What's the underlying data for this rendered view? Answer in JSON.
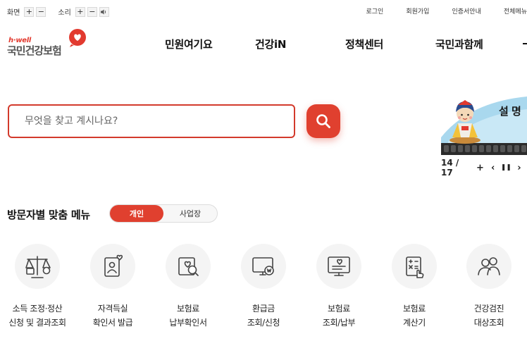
{
  "utility": {
    "screen_label": "화면",
    "sound_label": "소리",
    "plus": "+",
    "minus": "−",
    "links": [
      "로그인",
      "회원가입",
      "인증서안내",
      "전체메뉴"
    ]
  },
  "logo": {
    "tagline": "h·well",
    "name": "국민건강보험",
    "brand_color": "#e23a2f"
  },
  "gnb": {
    "items": [
      "민원여기요",
      "건강iN",
      "정책센터",
      "국민과함께"
    ]
  },
  "search": {
    "placeholder": "무엇을 찾고 계시나요?",
    "icon": "search-icon",
    "accent": "#e0402f"
  },
  "banner": {
    "text": "설 명",
    "counter": "14 / 17",
    "controls": {
      "add": "+",
      "prev": "‹",
      "pause": "❚❚",
      "next": "›"
    }
  },
  "custom_menu": {
    "title": "방문자별 맞춤 메뉴",
    "tabs": [
      "개인",
      "사업장"
    ],
    "active_tab": "개인",
    "items": [
      {
        "line1": "소득 조정·정산",
        "line2": "신청 및 결과조회",
        "icon": "scale-icon"
      },
      {
        "line1": "자격득실",
        "line2": "확인서 발급",
        "icon": "certificate-icon"
      },
      {
        "line1": "보험료",
        "line2": "납부확인서",
        "icon": "document-search-icon"
      },
      {
        "line1": "환급금",
        "line2": "조회/신청",
        "icon": "refund-monitor-icon"
      },
      {
        "line1": "보험료",
        "line2": "조회/납부",
        "icon": "payment-monitor-icon"
      },
      {
        "line1": "보험료",
        "line2": "계산기",
        "icon": "calculator-icon"
      },
      {
        "line1": "건강검진",
        "line2": "대상조회",
        "icon": "people-icon"
      }
    ]
  }
}
